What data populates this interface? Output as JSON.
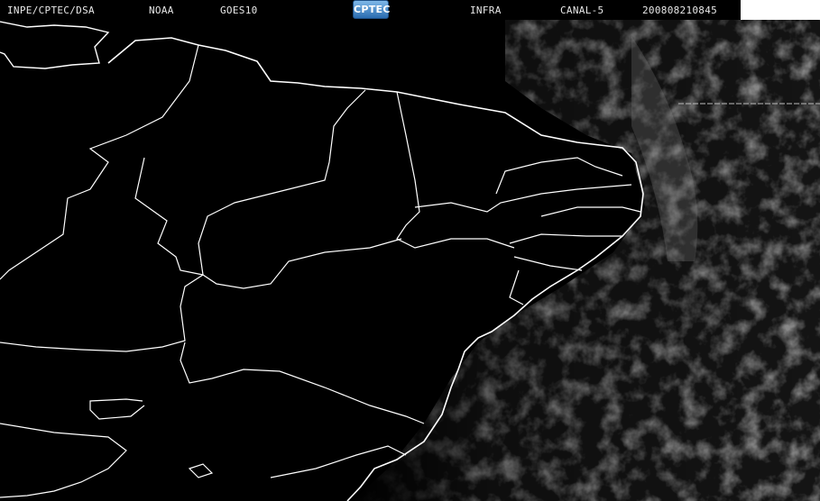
{
  "header": {
    "source": "INPE/CPTEC/DSA",
    "agency": "NOAA",
    "satellite": "GOES10",
    "logo_text": "CPTEC",
    "product": "INFRA",
    "channel": "CANAL-5",
    "datetime": "200808210845"
  },
  "colors": {
    "background": "#000000",
    "coastline": "#ffffff",
    "clouds": "#6e6e6e",
    "header_text": "#e8e8e8"
  }
}
